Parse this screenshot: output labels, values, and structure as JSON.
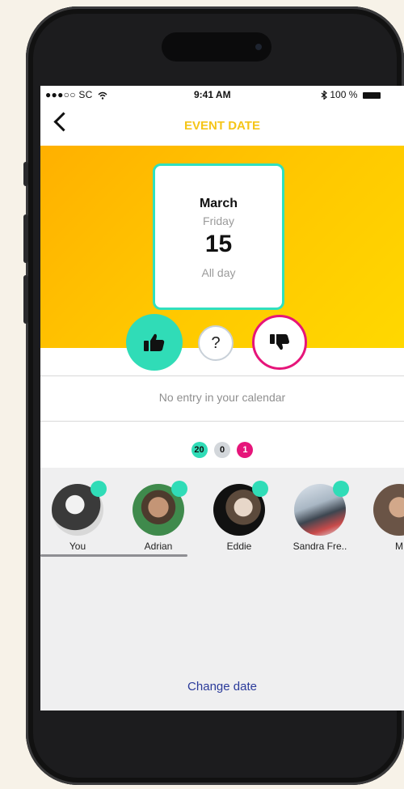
{
  "status_bar": {
    "carrier": "●●●○○ SC",
    "time": "9:41 AM",
    "battery": "100 %"
  },
  "nav": {
    "title": "EVENT DATE",
    "back_icon": "chevron-left-icon"
  },
  "date_card": {
    "month": "March",
    "weekday": "Friday",
    "day": "15",
    "duration": "All day"
  },
  "vote": {
    "yes_icon": "thumbs-up-icon",
    "maybe_label": "?",
    "no_icon": "thumbs-down-icon"
  },
  "calendar_status": "No entry in your calendar",
  "counts": {
    "yes": "20",
    "maybe": "0",
    "no": "1"
  },
  "participants": [
    {
      "name": "You"
    },
    {
      "name": "Adrian"
    },
    {
      "name": "Eddie"
    },
    {
      "name": "Sandra Fre.."
    },
    {
      "name": "M"
    }
  ],
  "change_date_label": "Change date",
  "colors": {
    "accent_teal": "#30dcb7",
    "title_yellow": "#f5c518",
    "decline_pink": "#e6157a",
    "link_blue": "#2a3a9a"
  }
}
